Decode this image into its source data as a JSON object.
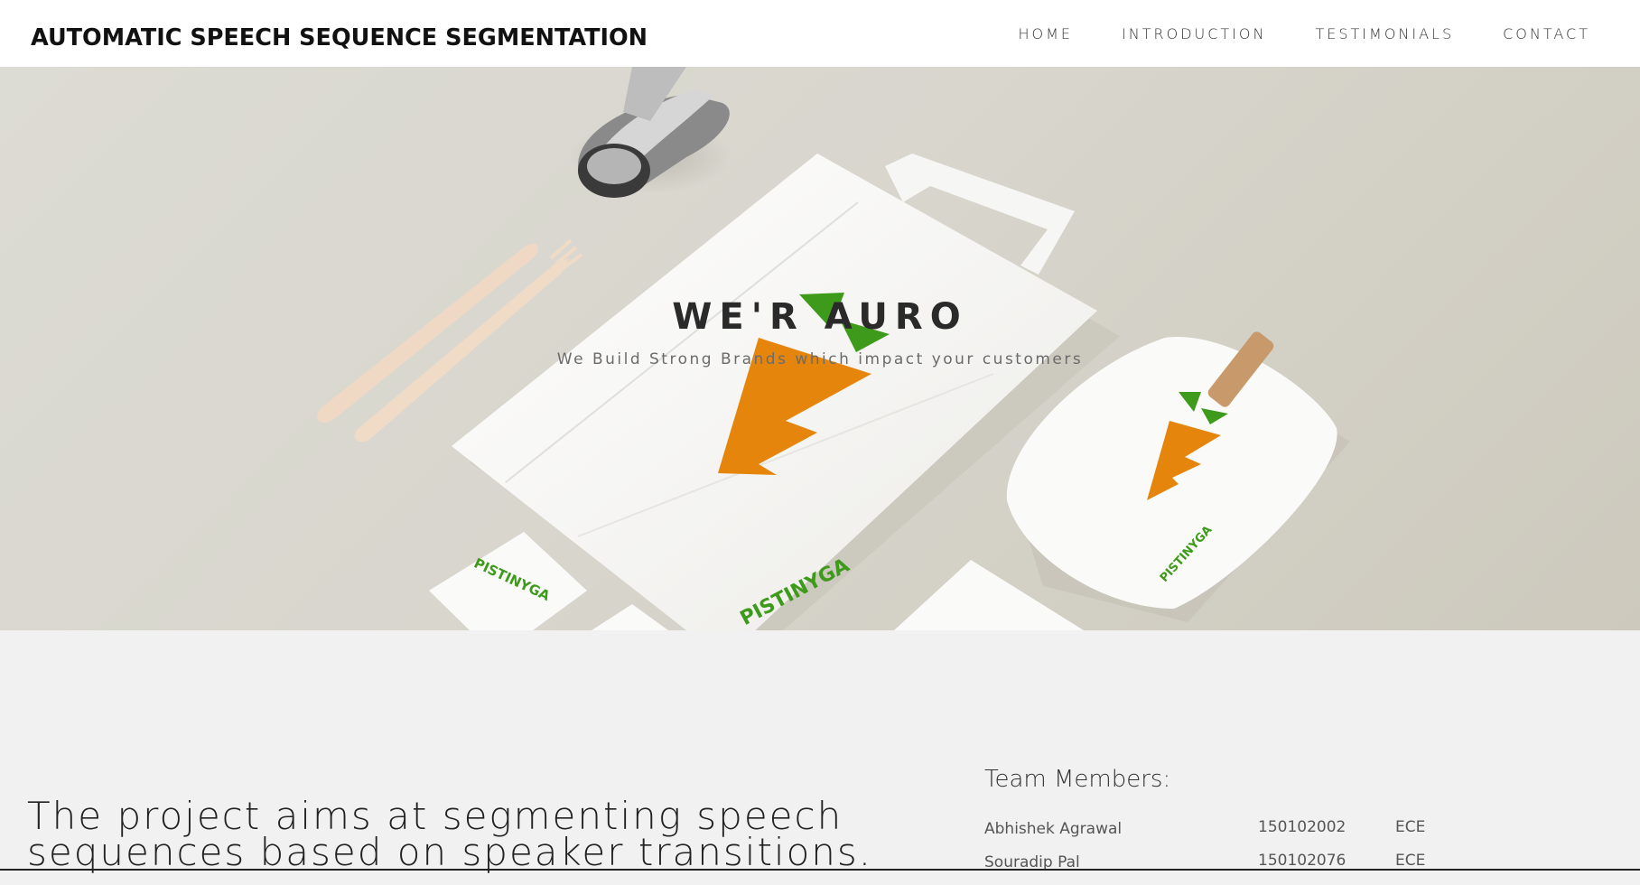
{
  "site": {
    "title": "AUTOMATIC SPEECH SEQUENCE SEGMENTATION"
  },
  "nav": {
    "items": [
      "HOME",
      "INTRODUCTION",
      "TESTIMONIALS",
      "CONTACT"
    ]
  },
  "hero": {
    "title": "WE'R AURO",
    "subtitle": "We Build Strong Brands which impact your customers",
    "brand_logo_text": "PISTINYGA",
    "colors": {
      "brand_orange": "#e6850c",
      "brand_green": "#3e9a1a",
      "background": "#d9d7cf"
    }
  },
  "intro": {
    "lead": "The project aims at segmenting speech sequences based on speaker transitions."
  },
  "team": {
    "heading": "Team Members:",
    "members": [
      {
        "name": "Abhishek Agrawal",
        "id": "150102002",
        "dept": "ECE"
      },
      {
        "name": "Souradip Pal",
        "id": "150102076",
        "dept": "ECE"
      }
    ]
  }
}
